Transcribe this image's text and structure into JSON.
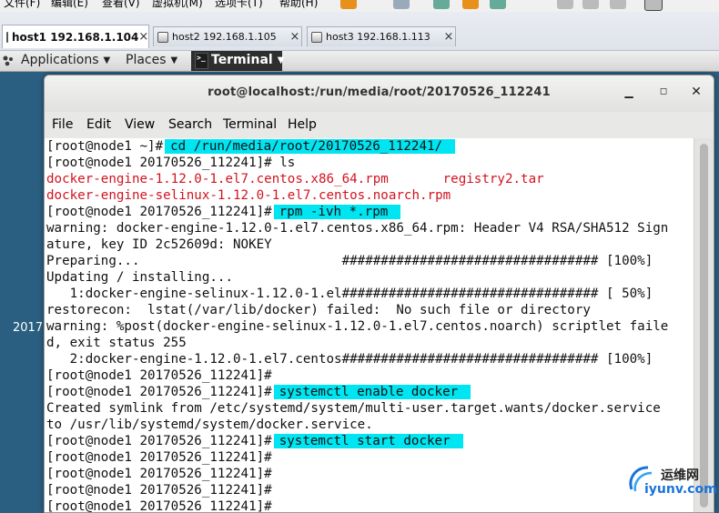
{
  "vm_menu": {
    "items": [
      "文件(F)",
      "编辑(E)",
      "查看(V)",
      "虚拟机(M)",
      "选项卡(T)",
      "帮助(H)"
    ]
  },
  "vm_tabs": [
    {
      "label": "host1 192.168.1.104",
      "active": true
    },
    {
      "label": "host2 192.168.1.105",
      "active": false
    },
    {
      "label": "host3 192.168.1.113",
      "active": false
    }
  ],
  "gnome": {
    "applications": "Applications",
    "places": "Places",
    "terminal": "Terminal"
  },
  "desktop": {
    "partial_label": "2017"
  },
  "terminal": {
    "title": "root@localhost:/run/media/root/20170526_112241",
    "menu": [
      "File",
      "Edit",
      "View",
      "Search",
      "Terminal",
      "Help"
    ],
    "lines": [
      {
        "prompt": "[root@node1 ~]#",
        "cmd": "cd /run/media/root/20170526_112241/",
        "highlight": true
      },
      {
        "prompt": "[root@node1 20170526_112241]#",
        "cmd": "ls"
      },
      {
        "segments": [
          {
            "text": "docker-engine-1.12.0-1.el7.centos.x86_64.rpm",
            "color": "red"
          },
          {
            "text": "       "
          },
          {
            "text": "registry2.tar",
            "color": "red"
          }
        ]
      },
      {
        "segments": [
          {
            "text": "docker-engine-selinux-1.12.0-1.el7.centos.noarch.rpm",
            "color": "red"
          }
        ]
      },
      {
        "prompt": "[root@node1 20170526_112241]#",
        "cmd": "rpm -ivh *.rpm",
        "highlight": true
      },
      {
        "text": "warning: docker-engine-1.12.0-1.el7.centos.x86_64.rpm: Header V4 RSA/SHA512 Sign"
      },
      {
        "text": "ature, key ID 2c52609d: NOKEY"
      },
      {
        "text": "Preparing...                          ################################# [100%]"
      },
      {
        "text": "Updating / installing..."
      },
      {
        "text": "   1:docker-engine-selinux-1.12.0-1.el################################# [ 50%]"
      },
      {
        "text": "restorecon:  lstat(/var/lib/docker) failed:  No such file or directory"
      },
      {
        "text": "warning: %post(docker-engine-selinux-1.12.0-1.el7.centos.noarch) scriptlet faile"
      },
      {
        "text": "d, exit status 255"
      },
      {
        "text": "   2:docker-engine-1.12.0-1.el7.centos################################# [100%]"
      },
      {
        "prompt": "[root@node1 20170526_112241]#",
        "cmd": ""
      },
      {
        "prompt": "[root@node1 20170526_112241]#",
        "cmd": "systemctl enable docker",
        "highlight": true
      },
      {
        "text": "Created symlink from /etc/systemd/system/multi-user.target.wants/docker.service"
      },
      {
        "text": "to /usr/lib/systemd/system/docker.service."
      },
      {
        "prompt": "[root@node1 20170526_112241]#",
        "cmd": "systemctl start docker",
        "highlight": true
      },
      {
        "prompt": "[root@node1 20170526_112241]#",
        "cmd": ""
      },
      {
        "prompt": "[root@node1 20170526_112241]#",
        "cmd": ""
      },
      {
        "prompt": "[root@node1 20170526_112241]#",
        "cmd": ""
      },
      {
        "prompt": "[root@node1 20170526_112241]#",
        "cmd": ""
      }
    ]
  },
  "watermark": {
    "cn": "运维网",
    "url": "iyunv.com"
  },
  "colors": {
    "highlight": "#00e5f2",
    "error_red": "#d1141f",
    "desktop": "#2b5f82"
  }
}
